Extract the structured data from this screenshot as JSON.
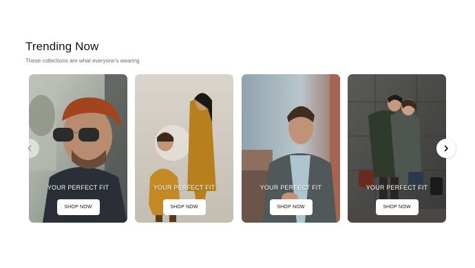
{
  "section": {
    "title": "Trending Now",
    "subtitle": "These collections are what everyone's wearing"
  },
  "carousel": {
    "prev_icon": "chevron-left-icon",
    "next_icon": "chevron-right-icon",
    "cards": [
      {
        "tagline": "YOUR PERFECT FIT",
        "button_label": "SHOP NOW",
        "image": "man in knit beanie and aviator sunglasses"
      },
      {
        "tagline": "YOUR PERFECT FIT",
        "button_label": "SHOP NOW",
        "image": "couple in mustard outfits"
      },
      {
        "tagline": "YOUR PERFECT FIT",
        "button_label": "SHOP NOW",
        "image": "man in tweed blazer checking watch"
      },
      {
        "tagline": "YOUR PERFECT FIT",
        "button_label": "SHOP NOW",
        "image": "couple embracing in winter coats"
      }
    ]
  },
  "colors": {
    "title": "#111111",
    "subtitle": "#6b6b6b",
    "button_bg": "#ffffff",
    "tagline": "#ffffff"
  }
}
